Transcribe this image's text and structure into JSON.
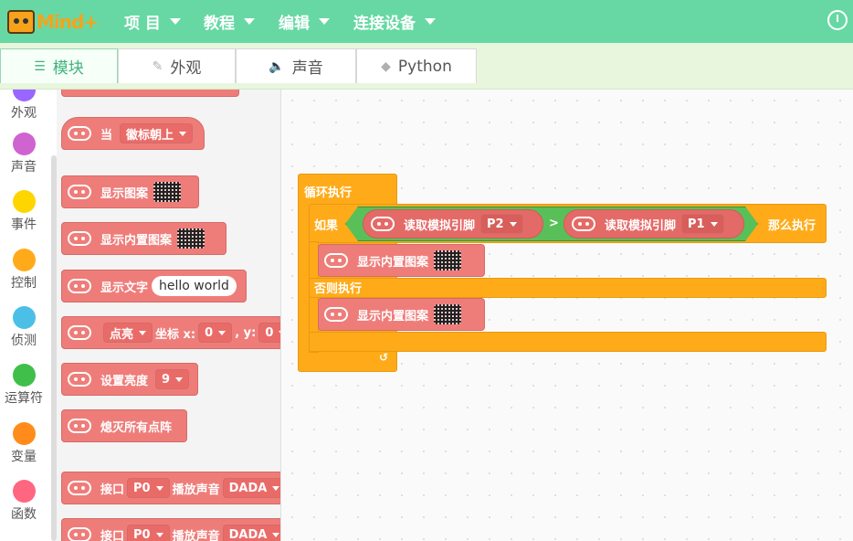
{
  "app": {
    "logo_text": "Mind+"
  },
  "menu": {
    "items": [
      {
        "label": "项 目"
      },
      {
        "label": "教程"
      },
      {
        "label": "编辑"
      },
      {
        "label": "连接设备"
      }
    ]
  },
  "tabs": [
    {
      "label": "模块",
      "icon": "blocks-icon"
    },
    {
      "label": "外观",
      "icon": "brush-icon"
    },
    {
      "label": "声音",
      "icon": "speaker-icon"
    },
    {
      "label": "Python",
      "icon": "python-icon"
    }
  ],
  "categories": [
    {
      "label": "外观",
      "color": "#9966ff"
    },
    {
      "label": "声音",
      "color": "#cf63cf"
    },
    {
      "label": "事件",
      "color": "#ffd500"
    },
    {
      "label": "控制",
      "color": "#ffab19"
    },
    {
      "label": "侦测",
      "color": "#4cbfe6"
    },
    {
      "label": "运算符",
      "color": "#40bf4a"
    },
    {
      "label": "变量",
      "color": "#ff8c1a"
    },
    {
      "label": "函数",
      "color": "#ff6680"
    }
  ],
  "palette": {
    "when_label": "当",
    "when_option": "徽标朝上",
    "show_image": "显示图案",
    "show_builtin": "显示内置图案",
    "show_text": "显示文字",
    "show_text_value": "hello world",
    "plot_option": "点亮",
    "coord_x_label": "坐标 x:",
    "coord_x_value": "0",
    "coord_y_label": ", y:",
    "coord_y_value": "0",
    "brightness_label": "设置亮度",
    "brightness_value": "9",
    "clear_label": "熄灭所有点阵",
    "pin_label": "接口",
    "pin_value": "P0",
    "play_label": "播放声音",
    "sound_value": "DADA"
  },
  "script": {
    "forever_label": "循环执行",
    "if_label": "如果",
    "read_analog_label": "读取模拟引脚",
    "pin_a": "P2",
    "compare_op": ">",
    "pin_b": "P1",
    "then_label": "那么执行",
    "show_builtin_a": "显示内置图案",
    "else_label": "否则执行",
    "show_builtin_b": "显示内置图案"
  }
}
